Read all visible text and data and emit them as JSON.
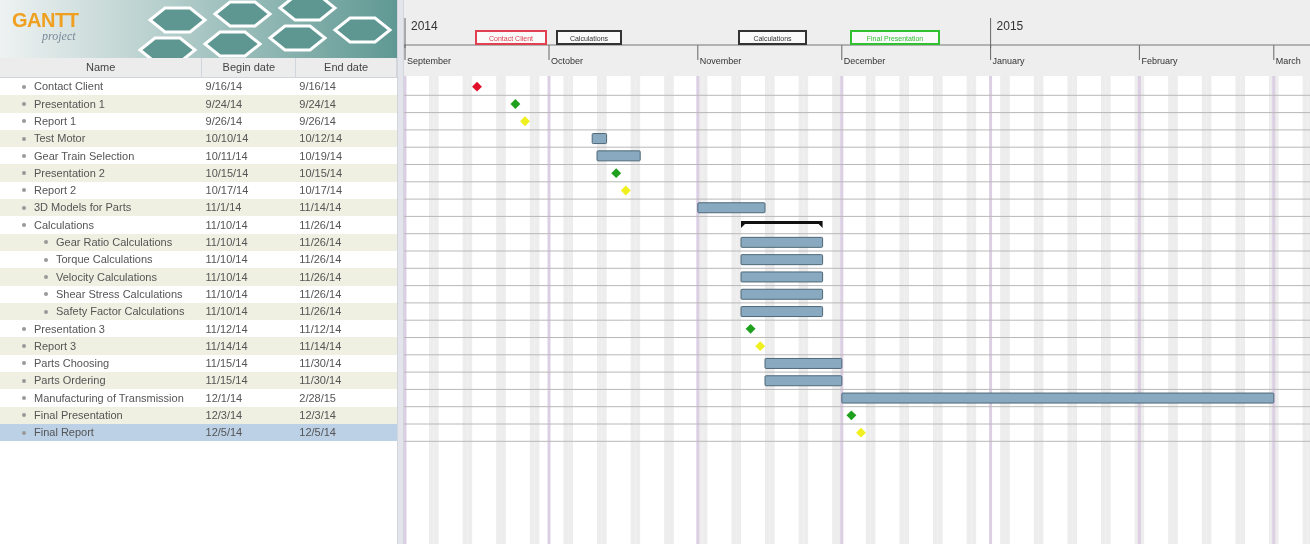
{
  "logo": {
    "title": "GANTT",
    "subtitle": "project"
  },
  "table": {
    "columns": [
      "Name",
      "Begin date",
      "End date"
    ],
    "rows": [
      {
        "name": "Contact Client",
        "begin": "9/16/14",
        "end": "9/16/14",
        "kind": "milestone",
        "color": "#e0102a",
        "selected": false
      },
      {
        "name": "Presentation 1",
        "begin": "9/24/14",
        "end": "9/24/14",
        "kind": "milestone",
        "color": "#1fa01f",
        "selected": false
      },
      {
        "name": "Report 1",
        "begin": "9/26/14",
        "end": "9/26/14",
        "kind": "milestone",
        "color": "#f0f020",
        "selected": false
      },
      {
        "name": "Test Motor",
        "begin": "10/10/14",
        "end": "10/12/14",
        "kind": "task",
        "selected": false
      },
      {
        "name": "Gear Train Selection",
        "begin": "10/11/14",
        "end": "10/19/14",
        "kind": "task",
        "selected": false
      },
      {
        "name": "Presentation 2",
        "begin": "10/15/14",
        "end": "10/15/14",
        "kind": "milestone",
        "color": "#1fa01f",
        "selected": false
      },
      {
        "name": "Report 2",
        "begin": "10/17/14",
        "end": "10/17/14",
        "kind": "milestone",
        "color": "#f0f020",
        "selected": false
      },
      {
        "name": "3D Models for Parts",
        "begin": "11/1/14",
        "end": "11/14/14",
        "kind": "task",
        "selected": false
      },
      {
        "name": "Calculations",
        "begin": "11/10/14",
        "end": "11/26/14",
        "kind": "summary",
        "selected": false,
        "children": [
          {
            "name": "Gear Ratio Calculations",
            "begin": "11/10/14",
            "end": "11/26/14",
            "kind": "task",
            "selected": false
          },
          {
            "name": "Torque Calculations",
            "begin": "11/10/14",
            "end": "11/26/14",
            "kind": "task",
            "selected": false
          },
          {
            "name": "Velocity Calculations",
            "begin": "11/10/14",
            "end": "11/26/14",
            "kind": "task",
            "selected": false
          },
          {
            "name": "Shear Stress Calculations",
            "begin": "11/10/14",
            "end": "11/26/14",
            "kind": "task",
            "selected": false
          },
          {
            "name": "Safety Factor Calculations",
            "begin": "11/10/14",
            "end": "11/26/14",
            "kind": "task",
            "selected": false
          }
        ]
      },
      {
        "name": "Presentation 3",
        "begin": "11/12/14",
        "end": "11/12/14",
        "kind": "milestone",
        "color": "#1fa01f",
        "selected": false
      },
      {
        "name": "Report 3",
        "begin": "11/14/14",
        "end": "11/14/14",
        "kind": "milestone",
        "color": "#f0f020",
        "selected": false
      },
      {
        "name": "Parts Choosing",
        "begin": "11/15/14",
        "end": "11/30/14",
        "kind": "task",
        "selected": false
      },
      {
        "name": "Parts Ordering",
        "begin": "11/15/14",
        "end": "11/30/14",
        "kind": "task",
        "selected": false
      },
      {
        "name": "Manufacturing of Transmission",
        "begin": "12/1/14",
        "end": "2/28/15",
        "kind": "task",
        "selected": false
      },
      {
        "name": "Final Presentation",
        "begin": "12/3/14",
        "end": "12/3/14",
        "kind": "milestone",
        "color": "#1fa01f",
        "selected": false
      },
      {
        "name": "Final Report",
        "begin": "12/5/14",
        "end": "12/5/14",
        "kind": "milestone",
        "color": "#f0f020",
        "selected": true
      }
    ]
  },
  "timeline": {
    "years": [
      "2014",
      "2015"
    ],
    "markers": [
      {
        "label": "Contact Client",
        "color": "#e04050"
      },
      {
        "label": "Calculations",
        "color": "#333333"
      },
      {
        "label": "Calculations",
        "color": "#333333"
      },
      {
        "label": "Final Presentation",
        "color": "#30c030"
      }
    ],
    "months": [
      "September",
      "October",
      "November",
      "December",
      "January",
      "February",
      "March"
    ]
  }
}
